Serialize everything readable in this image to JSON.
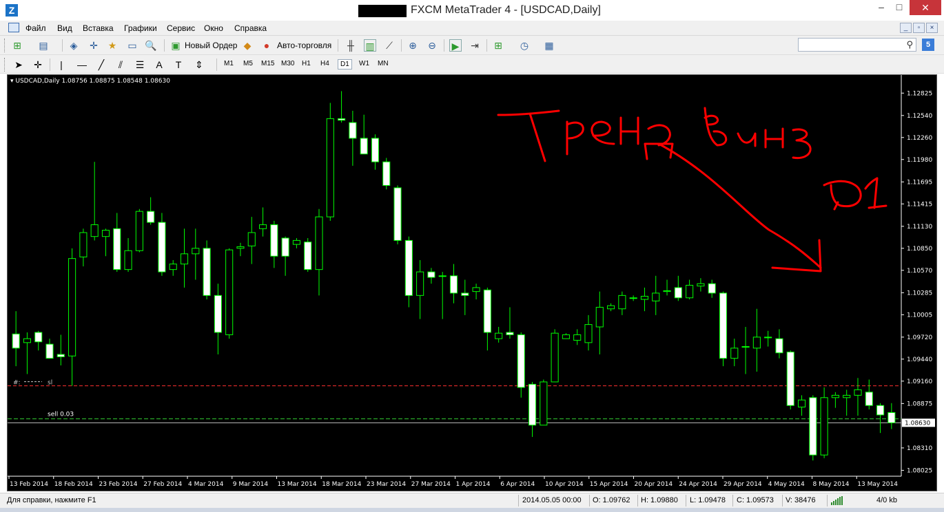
{
  "window": {
    "title": "FXCM MetaTrader 4 - [USDCAD,Daily]",
    "app_icon_glyph": "Z",
    "minimize": "–",
    "maximize": "□",
    "close": "✕"
  },
  "menu": {
    "items": [
      "Файл",
      "Вид",
      "Вставка",
      "Графики",
      "Сервис",
      "Окно",
      "Справка"
    ]
  },
  "toolbar": {
    "new_order_label": "Новый Ордер",
    "auto_trading_label": "Авто-торговля",
    "timeframes": [
      "M1",
      "M5",
      "M15",
      "M30",
      "H1",
      "H4",
      "D1",
      "W1",
      "MN"
    ],
    "active_timeframe": "D1",
    "search_placeholder": "",
    "notification_count": "5"
  },
  "chart": {
    "header": "USDCAD,Daily  1.08756 1.08875 1.08548 1.08630",
    "current_price_label": "1.08630",
    "sl_label": "sl",
    "sell_label": "sell 0.03",
    "hash_label": "#:"
  },
  "chart_data": {
    "type": "candlestick",
    "symbol": "USDCAD",
    "timeframe": "Daily",
    "y_ticks": [
      "1.12825",
      "1.12540",
      "1.12260",
      "1.11980",
      "1.11695",
      "1.11415",
      "1.11130",
      "1.10850",
      "1.10570",
      "1.10285",
      "1.10005",
      "1.09720",
      "1.09440",
      "1.09160",
      "1.08875",
      "1.08630",
      "1.08310",
      "1.08025"
    ],
    "ylim": [
      1.0795,
      1.1295
    ],
    "x_ticks": [
      "13 Feb 2014",
      "18 Feb 2014",
      "23 Feb 2014",
      "27 Feb 2014",
      "4 Mar 2014",
      "9 Mar 2014",
      "13 Mar 2014",
      "18 Mar 2014",
      "23 Mar 2014",
      "27 Mar 2014",
      "1 Apr 2014",
      "6 Apr 2014",
      "10 Apr 2014",
      "15 Apr 2014",
      "20 Apr 2014",
      "24 Apr 2014",
      "29 Apr 2014",
      "4 May 2014",
      "8 May 2014",
      "13 May 2014"
    ],
    "sl_level": 1.091,
    "sell_level": 1.0868,
    "current_price": 1.0863,
    "candles": [
      {
        "o": 1.0976,
        "h": 1.1005,
        "l": 1.0935,
        "c": 1.0958
      },
      {
        "o": 1.0965,
        "h": 1.0978,
        "l": 1.0925,
        "c": 1.097
      },
      {
        "o": 1.0978,
        "h": 1.098,
        "l": 1.0955,
        "c": 1.0966
      },
      {
        "o": 1.0963,
        "h": 1.097,
        "l": 1.0945,
        "c": 1.0945
      },
      {
        "o": 1.095,
        "h": 1.0975,
        "l": 1.0936,
        "c": 1.0947
      },
      {
        "o": 1.0948,
        "h": 1.1085,
        "l": 1.091,
        "c": 1.1072
      },
      {
        "o": 1.1074,
        "h": 1.111,
        "l": 1.1062,
        "c": 1.1105
      },
      {
        "o": 1.11,
        "h": 1.1195,
        "l": 1.1095,
        "c": 1.1115
      },
      {
        "o": 1.11,
        "h": 1.111,
        "l": 1.1075,
        "c": 1.1108
      },
      {
        "o": 1.111,
        "h": 1.113,
        "l": 1.1055,
        "c": 1.1058
      },
      {
        "o": 1.1058,
        "h": 1.1098,
        "l": 1.1055,
        "c": 1.1082
      },
      {
        "o": 1.1082,
        "h": 1.1135,
        "l": 1.108,
        "c": 1.1132
      },
      {
        "o": 1.1132,
        "h": 1.115,
        "l": 1.1115,
        "c": 1.1118
      },
      {
        "o": 1.1118,
        "h": 1.113,
        "l": 1.105,
        "c": 1.1055
      },
      {
        "o": 1.1058,
        "h": 1.107,
        "l": 1.105,
        "c": 1.1065
      },
      {
        "o": 1.1065,
        "h": 1.111,
        "l": 1.1035,
        "c": 1.1078
      },
      {
        "o": 1.1078,
        "h": 1.111,
        "l": 1.1045,
        "c": 1.1085
      },
      {
        "o": 1.1085,
        "h": 1.1095,
        "l": 1.102,
        "c": 1.1025
      },
      {
        "o": 1.1025,
        "h": 1.104,
        "l": 1.095,
        "c": 1.0978
      },
      {
        "o": 1.0975,
        "h": 1.1085,
        "l": 1.097,
        "c": 1.1083
      },
      {
        "o": 1.1085,
        "h": 1.1092,
        "l": 1.1075,
        "c": 1.1087
      },
      {
        "o": 1.1088,
        "h": 1.1125,
        "l": 1.1065,
        "c": 1.1105
      },
      {
        "o": 1.111,
        "h": 1.1137,
        "l": 1.11,
        "c": 1.1115
      },
      {
        "o": 1.1115,
        "h": 1.112,
        "l": 1.106,
        "c": 1.1075
      },
      {
        "o": 1.1098,
        "h": 1.11,
        "l": 1.105,
        "c": 1.1075
      },
      {
        "o": 1.109,
        "h": 1.1098,
        "l": 1.1085,
        "c": 1.1095
      },
      {
        "o": 1.1093,
        "h": 1.1098,
        "l": 1.1055,
        "c": 1.1058
      },
      {
        "o": 1.1058,
        "h": 1.1135,
        "l": 1.1025,
        "c": 1.1125
      },
      {
        "o": 1.1125,
        "h": 1.127,
        "l": 1.112,
        "c": 1.125
      },
      {
        "o": 1.125,
        "h": 1.1285,
        "l": 1.1245,
        "c": 1.1248
      },
      {
        "o": 1.1245,
        "h": 1.126,
        "l": 1.119,
        "c": 1.1225
      },
      {
        "o": 1.1225,
        "h": 1.1255,
        "l": 1.1205,
        "c": 1.1205
      },
      {
        "o": 1.1225,
        "h": 1.123,
        "l": 1.1185,
        "c": 1.1195
      },
      {
        "o": 1.1195,
        "h": 1.12,
        "l": 1.116,
        "c": 1.1165
      },
      {
        "o": 1.1162,
        "h": 1.1165,
        "l": 1.109,
        "c": 1.1095
      },
      {
        "o": 1.1095,
        "h": 1.11,
        "l": 1.101,
        "c": 1.1025
      },
      {
        "o": 1.1025,
        "h": 1.107,
        "l": 1.0995,
        "c": 1.1055
      },
      {
        "o": 1.1055,
        "h": 1.106,
        "l": 1.104,
        "c": 1.1048
      },
      {
        "o": 1.105,
        "h": 1.1055,
        "l": 1.0995,
        "c": 1.105
      },
      {
        "o": 1.105,
        "h": 1.1065,
        "l": 1.1015,
        "c": 1.1028
      },
      {
        "o": 1.1028,
        "h": 1.1045,
        "l": 1.1,
        "c": 1.1025
      },
      {
        "o": 1.103,
        "h": 1.104,
        "l": 1.102,
        "c": 1.1035
      },
      {
        "o": 1.1032,
        "h": 1.1035,
        "l": 1.0955,
        "c": 1.0978
      },
      {
        "o": 1.097,
        "h": 1.0985,
        "l": 1.0965,
        "c": 1.0977
      },
      {
        "o": 1.0978,
        "h": 1.101,
        "l": 1.097,
        "c": 1.0975
      },
      {
        "o": 1.0975,
        "h": 1.0978,
        "l": 1.0895,
        "c": 1.0908
      },
      {
        "o": 1.0912,
        "h": 1.0915,
        "l": 1.0845,
        "c": 1.086
      },
      {
        "o": 1.086,
        "h": 1.0918,
        "l": 1.086,
        "c": 1.0915
      },
      {
        "o": 1.0915,
        "h": 1.0982,
        "l": 1.0915,
        "c": 1.0977
      },
      {
        "o": 1.097,
        "h": 1.0977,
        "l": 1.097,
        "c": 1.0975
      },
      {
        "o": 1.0968,
        "h": 1.0982,
        "l": 1.0962,
        "c": 1.0975
      },
      {
        "o": 1.0965,
        "h": 1.1,
        "l": 1.0955,
        "c": 1.0988
      },
      {
        "o": 1.0985,
        "h": 1.103,
        "l": 1.095,
        "c": 1.101
      },
      {
        "o": 1.1008,
        "h": 1.1015,
        "l": 1.1005,
        "c": 1.1012
      },
      {
        "o": 1.1008,
        "h": 1.103,
        "l": 1.1,
        "c": 1.1025
      },
      {
        "o": 1.1022,
        "h": 1.1025,
        "l": 1.1018,
        "c": 1.1022
      },
      {
        "o": 1.102,
        "h": 1.1035,
        "l": 1.1005,
        "c": 1.1024
      },
      {
        "o": 1.1018,
        "h": 1.105,
        "l": 1.1,
        "c": 1.1028
      },
      {
        "o": 1.103,
        "h": 1.1045,
        "l": 1.1025,
        "c": 1.1031
      },
      {
        "o": 1.1035,
        "h": 1.105,
        "l": 1.1018,
        "c": 1.1022
      },
      {
        "o": 1.1022,
        "h": 1.1045,
        "l": 1.102,
        "c": 1.1038
      },
      {
        "o": 1.1037,
        "h": 1.1047,
        "l": 1.103,
        "c": 1.104
      },
      {
        "o": 1.104,
        "h": 1.1045,
        "l": 1.1022,
        "c": 1.1028
      },
      {
        "o": 1.1028,
        "h": 1.103,
        "l": 1.0935,
        "c": 1.0945
      },
      {
        "o": 1.0945,
        "h": 1.097,
        "l": 1.0935,
        "c": 1.0958
      },
      {
        "o": 1.096,
        "h": 1.0985,
        "l": 1.0925,
        "c": 1.096
      },
      {
        "o": 1.0958,
        "h": 1.1008,
        "l": 1.0928,
        "c": 1.0972
      },
      {
        "o": 1.0972,
        "h": 1.098,
        "l": 1.096,
        "c": 1.0972
      },
      {
        "o": 1.097,
        "h": 1.0982,
        "l": 1.0945,
        "c": 1.0952
      },
      {
        "o": 1.0953,
        "h": 1.0955,
        "l": 1.088,
        "c": 1.0885
      },
      {
        "o": 1.0883,
        "h": 1.0898,
        "l": 1.0872,
        "c": 1.0892
      },
      {
        "o": 1.0895,
        "h": 1.0898,
        "l": 1.0815,
        "c": 1.0822
      },
      {
        "o": 1.0822,
        "h": 1.0908,
        "l": 1.0818,
        "c": 1.0895
      },
      {
        "o": 1.0895,
        "h": 1.0902,
        "l": 1.0882,
        "c": 1.0898
      },
      {
        "o": 1.0895,
        "h": 1.0905,
        "l": 1.0872,
        "c": 1.0898
      },
      {
        "o": 1.0898,
        "h": 1.092,
        "l": 1.0872,
        "c": 1.0905
      },
      {
        "o": 1.0902,
        "h": 1.0918,
        "l": 1.088,
        "c": 1.0885
      },
      {
        "o": 1.0885,
        "h": 1.0888,
        "l": 1.085,
        "c": 1.0873
      },
      {
        "o": 1.0876,
        "h": 1.0888,
        "l": 1.0855,
        "c": 1.0863
      }
    ],
    "annotations": [
      {
        "text": "тренд вниз",
        "color": "#ff0000",
        "style": "handwritten"
      },
      {
        "text": "D1",
        "color": "#ff0000",
        "style": "handwritten"
      }
    ],
    "colors": {
      "background": "#000000",
      "bull_fill": "#000000",
      "bear_fill": "#ffffff",
      "wick": "#00ff00",
      "axis": "#ffffff",
      "sl_line": "#ff3030",
      "sell_line": "#33cc33",
      "annotation": "#ff0000"
    }
  },
  "status": {
    "help_text": "Для справки, нажмите F1",
    "datetime": "2014.05.05 00:00",
    "open": "O: 1.09762",
    "high": "H: 1.09880",
    "low": "L: 1.09478",
    "close": "C: 1.09573",
    "volume": "V: 38476",
    "traffic": "4/0 kb"
  }
}
